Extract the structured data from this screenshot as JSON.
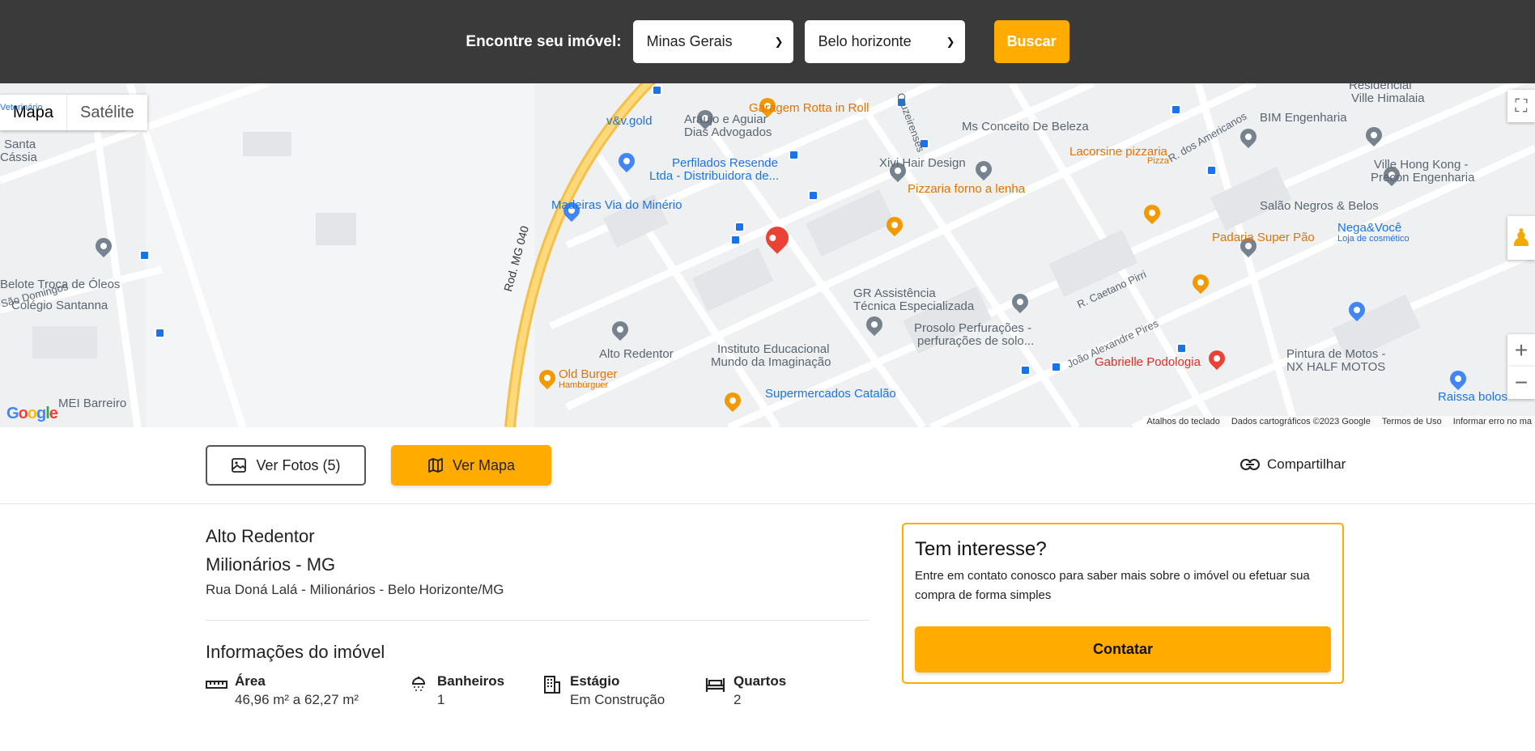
{
  "header": {
    "search_label": "Encontre seu imóvel:",
    "state_select": "Minas Gerais",
    "city_select": "Belo horizonte",
    "search_button": "Buscar"
  },
  "map": {
    "type_map": "Mapa",
    "type_satellite": "Satélite",
    "attribution": {
      "shortcuts": "Atalhos do teclado",
      "data": "Dados cartográficos ©2023 Google",
      "terms": "Termos de Uso",
      "report": "Informar erro no ma"
    },
    "logo": "Google",
    "places": {
      "p1": "Garagem Rotta in Roll",
      "p2": "v&v.gold",
      "p3": "Araujo e Aguiar",
      "p3b": "Dias Advogados",
      "p4": "Perfilados Resende",
      "p4b": "Ltda - Distribuidora de...",
      "p5": "Madeiras Via do Minério",
      "p6": "Ms Conceito De Beleza",
      "p7": "Xivi Hair Design",
      "p8": "Pizzaria forno a lenha",
      "p9": "Lacorsine pizzaria",
      "p9b": "Pizza",
      "p10": "BIM Engenharia",
      "p11": "Residencial",
      "p11b": "Ville Himalaia",
      "p12": "Ville Hong Kong -",
      "p12b": "Precon Engenharia",
      "p13": "Salão Negros & Belos",
      "p14": "Padaria Super Pão",
      "p15": "Nega&Você",
      "p15b": "Loja de cosmético",
      "p16": "GR Assistência",
      "p16b": "Técnica Especializada",
      "p17": "Prosolo Perfurações -",
      "p17b": "perfurações de solo...",
      "p18": "Alto Redentor",
      "p19": "Instituto Educacional",
      "p19b": "Mundo da Imaginação",
      "p20": "Gabrielle Podologia",
      "p21": "Pintura de Motos -",
      "p21b": "NX HALF MOTOS",
      "p22": "Old Burger",
      "p22b": "Hambúrguer",
      "p23": "Supermercados Catalão",
      "p24": "Raissa bolos",
      "p25": "MEI Barreiro",
      "p26": "Belote Troca de Óleos",
      "p27": "Colégio Santanna",
      "p28": "Santa",
      "p28b": "Cássia",
      "p29": "Veterinário",
      "r1": "Rod. MG 040",
      "r2": "R. dos Americanos",
      "r3": "R. Caetano Pirri",
      "r4": "João Alexandre Pires",
      "r5": "Cruzeirenses",
      "r6": "São Domingos"
    }
  },
  "actions": {
    "photos_button": "Ver Fotos (5)",
    "map_button": "Ver Mapa",
    "share_button": "Compartilhar"
  },
  "property": {
    "title": "Alto Redentor",
    "subtitle": "Milionários - MG",
    "address": "Rua Doná Lalá - Milionários - Belo Horizonte/MG",
    "section_title": "Informações do imóvel",
    "features": [
      {
        "icon": "ruler-icon",
        "label": "Área",
        "value": "46,96 m² a 62,27 m²"
      },
      {
        "icon": "shower-icon",
        "label": "Banheiros",
        "value": "1"
      },
      {
        "icon": "building-icon",
        "label": "Estágio",
        "value": "Em Construção"
      },
      {
        "icon": "bed-icon",
        "label": "Quartos",
        "value": "2"
      }
    ]
  },
  "contact_card": {
    "title": "Tem interesse?",
    "text": "Entre em contato conosco para saber mais sobre o imóvel ou efetuar sua compra de forma simples",
    "button": "Contatar"
  },
  "colors": {
    "accent": "#ffab00",
    "header_bg": "#3a3a3a"
  }
}
